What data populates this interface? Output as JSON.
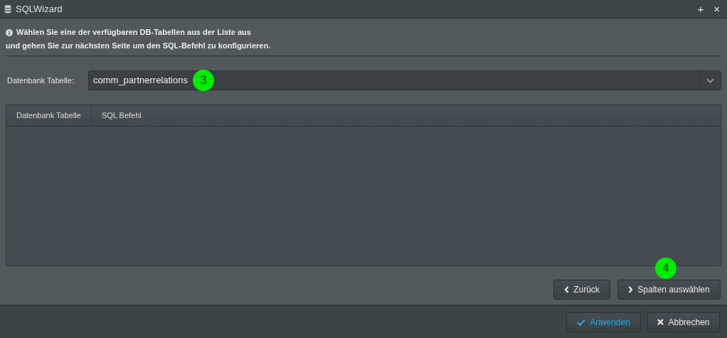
{
  "window": {
    "title": "SQLWizard",
    "controls": [
      "+",
      "×"
    ]
  },
  "info": {
    "lines": [
      "Wählen Sie eine der verfügbaren DB-Tabellen aus der Liste aus",
      "und gehen Sie zur nächsten Seite um den SQL-Befehl zu konfigurieren."
    ]
  },
  "table_select": {
    "label": "Datenbank Tabelle:",
    "value": "comm_partnerrelations"
  },
  "table": {
    "columns": [
      "Datenbank Tabelle",
      "SQL Befehl"
    ]
  },
  "nav_buttons": [
    {
      "label": "Zurück",
      "kind": "back"
    },
    {
      "label": "Spalten auswählen",
      "kind": "next"
    }
  ],
  "footer_buttons": [
    {
      "label": "Anwenden",
      "kind": "apply"
    },
    {
      "label": "Abbrechen",
      "kind": "cancel"
    }
  ],
  "markers": [
    {
      "label": "3"
    },
    {
      "label": "4"
    }
  ]
}
